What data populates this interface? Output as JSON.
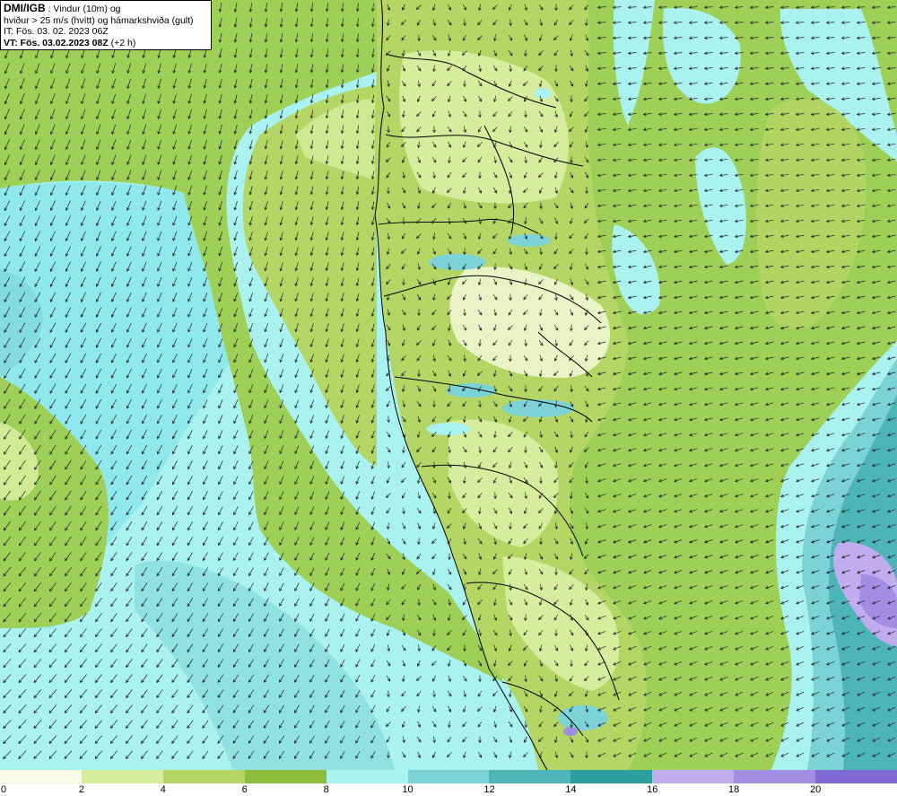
{
  "info": {
    "title": "DMI/IGB",
    "title_suffix": " : Vindur (10m) og",
    "line2": "hviður > 25 m/s (hvítt) og hámarkshviða (gult)",
    "line3": "IT: Fös. 03. 02. 2023 06Z",
    "vt_bold": "VT: Fös. 03.02.2023 08Z",
    "vt_suffix": " (+2 h)"
  },
  "legend": {
    "ticks": [
      "0",
      "2",
      "4",
      "6",
      "8",
      "10",
      "12",
      "14",
      "16",
      "18",
      "20"
    ],
    "colors": [
      "#f7fbe3",
      "#d7ec9c",
      "#b3d665",
      "#8dbd3a",
      "#a9f2f0",
      "#7bd3d5",
      "#4db5b8",
      "#2c9e9e",
      "#c0acef",
      "#a08ee3",
      "#7f6ad4"
    ]
  },
  "map_colors": {
    "ocean_strong": "#8fe8ec",
    "ocean_deep": "#6cc9cf",
    "ocean_mid": "#a9f2f0",
    "calm_water": "#9ecf57",
    "land": "#b3d665",
    "land_light": "#d7ec9c",
    "land_pale": "#f3f8d6",
    "peak_purple": "#a08ee3",
    "arrow": "#222222",
    "coast": "#000000"
  }
}
